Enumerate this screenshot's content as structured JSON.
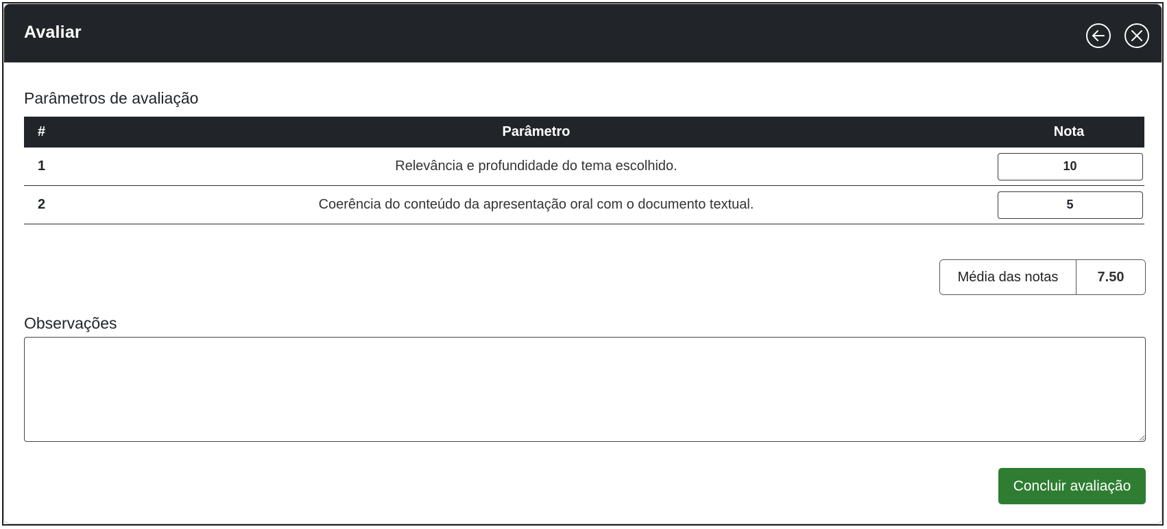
{
  "modal": {
    "title": "Avaliar"
  },
  "parameters": {
    "section_title": "Parâmetros de avaliação",
    "columns": {
      "num": "#",
      "param": "Parâmetro",
      "nota": "Nota"
    },
    "rows": [
      {
        "num": "1",
        "param": "Relevância e profundidade do tema escolhido.",
        "nota": "10"
      },
      {
        "num": "2",
        "param": "Coerência do conteúdo da apresentação oral com o documento textual.",
        "nota": "5"
      }
    ]
  },
  "average": {
    "label": "Média das notas",
    "value": "7.50"
  },
  "observations": {
    "title": "Observações",
    "value": ""
  },
  "actions": {
    "submit_label": "Concluir avaliação"
  },
  "colors": {
    "header_bg": "#212529",
    "submit_bg": "#2e7d32"
  },
  "icons": {
    "back": "arrow-left-circle-icon",
    "close": "x-circle-icon"
  }
}
